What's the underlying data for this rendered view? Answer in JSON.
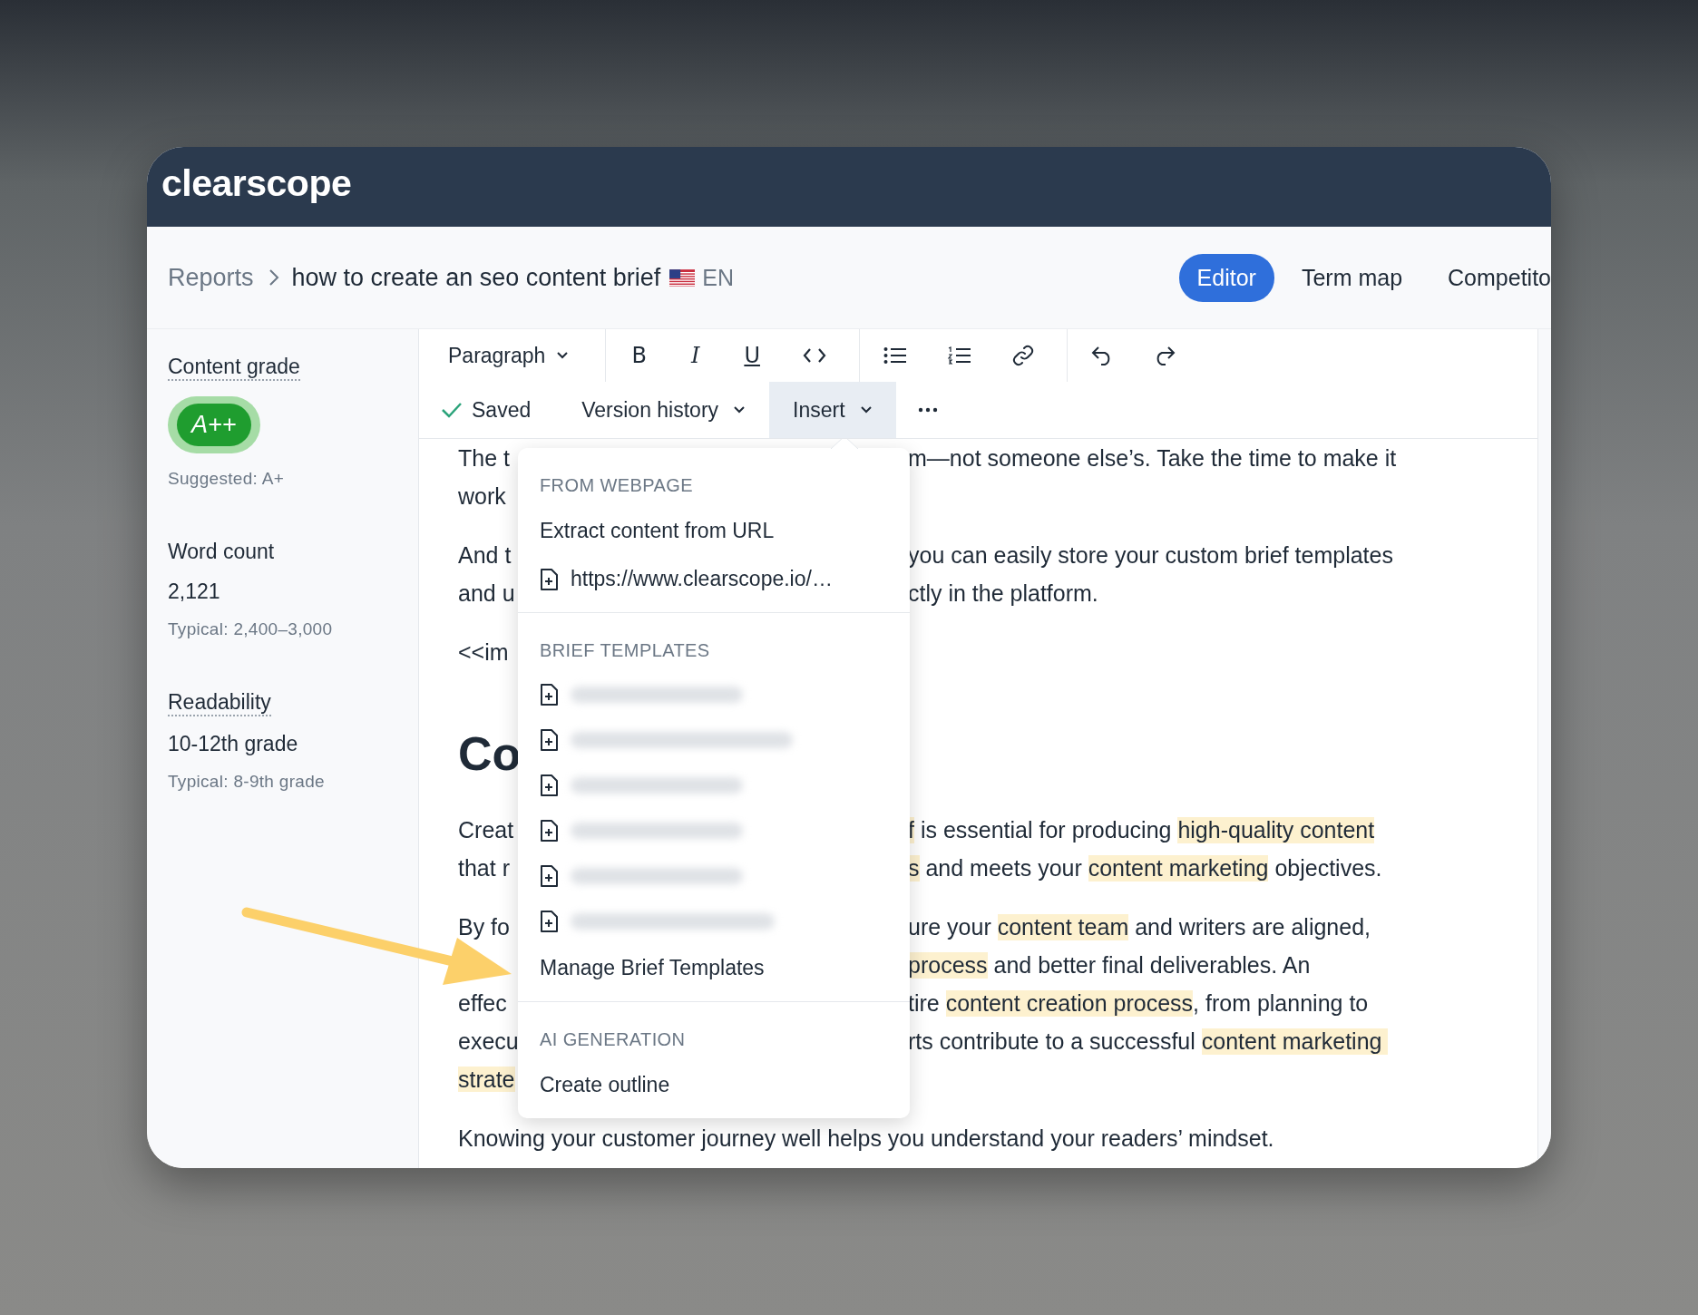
{
  "app": {
    "logo": "clearscope"
  },
  "breadcrumb": {
    "root": "Reports",
    "title": "how to create an seo content brief",
    "language": "EN"
  },
  "view_tabs": [
    {
      "label": "Editor",
      "selected": true
    },
    {
      "label": "Term map",
      "selected": false
    },
    {
      "label": "Competito",
      "selected": false
    }
  ],
  "metrics": [
    {
      "kind": "grade",
      "label": "Content grade",
      "dotted_underline": true,
      "value": "A++",
      "note": "Suggested: A+"
    },
    {
      "kind": "number",
      "label": "Word count",
      "dotted_underline": false,
      "value": "2,121",
      "note": "Typical: 2,400–3,000"
    },
    {
      "kind": "number",
      "label": "Readability",
      "dotted_underline": true,
      "value": "10-12th grade",
      "note": "Typical: 8-9th grade"
    }
  ],
  "toolbar": {
    "block_style": "Paragraph",
    "tool_groups": [
      [
        {
          "kind": "bold",
          "label": "B"
        },
        {
          "kind": "italic",
          "label": "I"
        },
        {
          "kind": "underline",
          "label": "U"
        },
        {
          "kind": "code"
        }
      ],
      [
        {
          "kind": "bullet-list"
        },
        {
          "kind": "numbered-list"
        },
        {
          "kind": "link"
        }
      ],
      [
        {
          "kind": "undo"
        },
        {
          "kind": "redo"
        }
      ]
    ],
    "status": "Saved",
    "menus": [
      {
        "label": "Version history",
        "selected": false
      },
      {
        "label": "Insert",
        "selected": true
      }
    ]
  },
  "insert_menu": {
    "sections": [
      {
        "heading": "FROM WEBPAGE",
        "items": [
          {
            "kind": "action",
            "label": "Extract content from URL"
          },
          {
            "kind": "file",
            "label": "https://www.clearscope.io/…"
          }
        ]
      },
      {
        "heading": "BRIEF TEMPLATES",
        "items": [
          {
            "kind": "redacted"
          },
          {
            "kind": "redacted"
          },
          {
            "kind": "redacted"
          },
          {
            "kind": "redacted"
          },
          {
            "kind": "redacted"
          },
          {
            "kind": "redacted"
          },
          {
            "kind": "action",
            "label": "Manage Brief Templates"
          }
        ]
      },
      {
        "heading": "AI GENERATION",
        "items": [
          {
            "kind": "action",
            "label": "Create outline"
          }
        ]
      }
    ]
  },
  "editor": {
    "paragraphs": [
      {
        "kind": "text",
        "lines": [
          {
            "left": [
              {
                "text": "The t",
                "highlight": false
              }
            ],
            "right": [
              {
                "text": "m—not someone else’s. Take the time to make it",
                "highlight": false
              }
            ]
          },
          {
            "left": [
              {
                "text": "work",
                "highlight": false
              }
            ]
          }
        ]
      },
      {
        "kind": "text",
        "lines": [
          {
            "left": [
              {
                "text": "And t",
                "highlight": false
              }
            ],
            "right": [
              {
                "text": "you can easily store your custom brief templates",
                "highlight": false
              }
            ]
          },
          {
            "left": [
              {
                "text": "and u",
                "highlight": false
              }
            ],
            "right": [
              {
                "text": "ctly in the platform.",
                "highlight": false
              }
            ]
          }
        ]
      },
      {
        "kind": "text",
        "lines": [
          {
            "left": [
              {
                "text": "<<im",
                "highlight": false
              }
            ]
          }
        ]
      },
      {
        "kind": "heading",
        "lines": [
          {
            "left": [
              {
                "text": "Co",
                "highlight": false
              }
            ]
          }
        ]
      },
      {
        "kind": "text",
        "lines": [
          {
            "left": [
              {
                "text": "Creat",
                "highlight": false
              }
            ],
            "right": [
              {
                "text": "f",
                "highlight": true
              },
              {
                "text": " is essential for producing ",
                "highlight": false
              },
              {
                "text": "high-quality content",
                "highlight": true
              }
            ]
          },
          {
            "left": [
              {
                "text": "that r",
                "highlight": false
              }
            ],
            "right": [
              {
                "text": "s",
                "highlight": true
              },
              {
                "text": " and meets your ",
                "highlight": false
              },
              {
                "text": "content marketing",
                "highlight": true
              },
              {
                "text": " objectives.",
                "highlight": false
              }
            ]
          }
        ]
      },
      {
        "kind": "text",
        "lines": [
          {
            "left": [
              {
                "text": "By fo",
                "highlight": false
              }
            ],
            "right": [
              {
                "text": "ure your ",
                "highlight": false
              },
              {
                "text": "content team",
                "highlight": true
              },
              {
                "text": " and writers are aligned,",
                "highlight": false
              }
            ]
          },
          {
            "right": [
              {
                "text": "process",
                "highlight": true
              },
              {
                "text": " and better final deliverables. An",
                "highlight": false
              }
            ]
          },
          {
            "left": [
              {
                "text": "effec",
                "highlight": false
              }
            ],
            "right": [
              {
                "text": "tire ",
                "highlight": false
              },
              {
                "text": "content creation process",
                "highlight": true
              },
              {
                "text": ", from planning to",
                "highlight": false
              }
            ]
          },
          {
            "left": [
              {
                "text": "execu",
                "highlight": false
              }
            ],
            "right": [
              {
                "text": "rts contribute to a successful ",
                "highlight": false
              },
              {
                "text": "content marketing ",
                "highlight": true
              }
            ]
          },
          {
            "left": [
              {
                "text": "strate",
                "highlight": true
              }
            ]
          }
        ]
      },
      {
        "kind": "text",
        "lines": [
          {
            "full": [
              {
                "text": "Knowing your customer journey well helps you understand your readers’ mindset.",
                "highlight": false
              }
            ]
          }
        ]
      }
    ]
  }
}
